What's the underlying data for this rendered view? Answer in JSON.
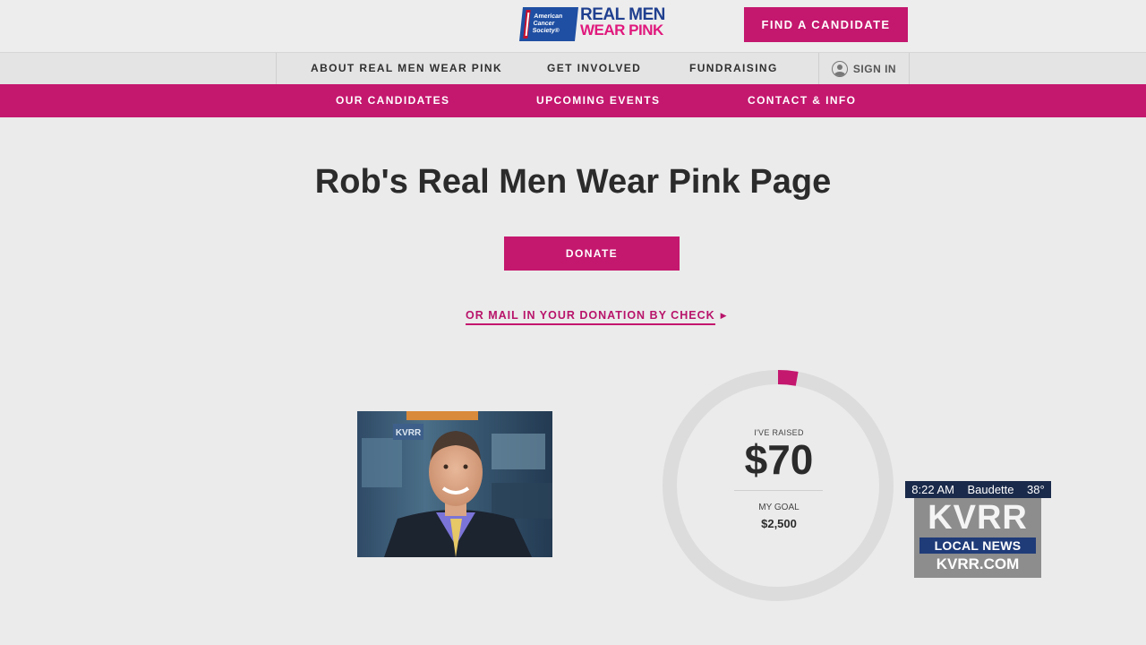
{
  "header": {
    "logo": {
      "acs_text": "American Cancer Society®",
      "rmwp_line1": "REAL MEN",
      "rmwp_line2": "WEAR PINK"
    },
    "find_candidate_label": "FIND A CANDIDATE"
  },
  "nav_primary": {
    "items": [
      {
        "label": "ABOUT REAL MEN WEAR PINK"
      },
      {
        "label": "GET INVOLVED"
      },
      {
        "label": "FUNDRAISING"
      }
    ],
    "sign_in_label": "SIGN IN"
  },
  "nav_secondary": {
    "items": [
      {
        "label": "OUR CANDIDATES"
      },
      {
        "label": "UPCOMING EVENTS"
      },
      {
        "label": "CONTACT & INFO"
      }
    ]
  },
  "main": {
    "title": "Rob's Real Men Wear Pink Page",
    "donate_label": "DONATE",
    "mail_link_label": "OR MAIL IN YOUR DONATION BY CHECK"
  },
  "progress": {
    "raised_label": "I'VE RAISED",
    "raised_amount": "$70",
    "goal_label": "MY GOAL",
    "goal_amount": "$2,500",
    "fraction": 0.028,
    "accent_color": "#c4176e",
    "track_color": "#dcdcdc"
  },
  "tv_overlay": {
    "time": "8:22 AM",
    "location": "Baudette",
    "temperature": "38°",
    "call_letters": "KVRR",
    "local_news": "LOCAL NEWS",
    "website": "KVRR.COM"
  },
  "photo": {
    "wall_logo_text": "KVRR"
  },
  "colors": {
    "brand_pink": "#c4176e",
    "background": "#ebebeb"
  }
}
